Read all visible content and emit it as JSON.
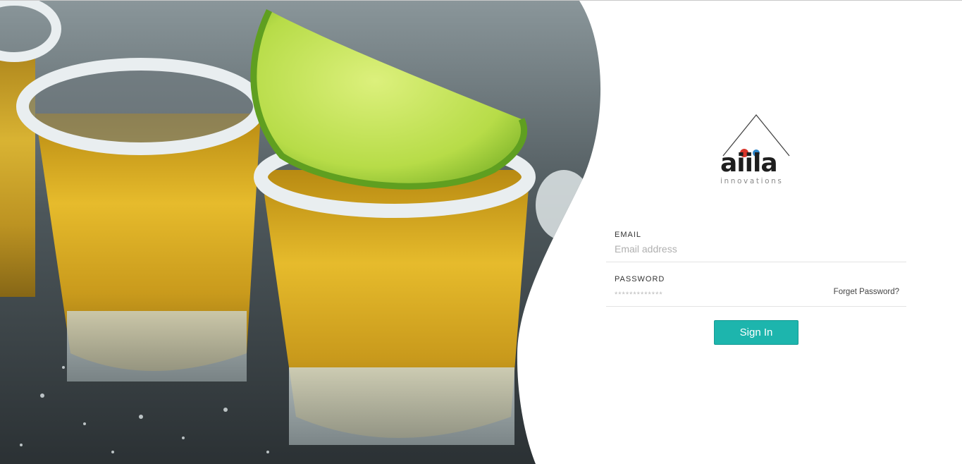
{
  "brand": {
    "name": "aiila",
    "sub": "innovations",
    "colors": {
      "roof": "#444444",
      "red_dot": "#d9352b",
      "blue_dot": "#2e86c9",
      "text": "#1e1e1e"
    }
  },
  "hero": {
    "description_icon": "tequila-shots-image",
    "colors": {
      "backdrop": "#3c4448",
      "liquid": "#d6a820",
      "salt": "#e9eef0",
      "lime": "#a8d53a"
    }
  },
  "form": {
    "email": {
      "label": "EMAIL",
      "placeholder": "Email address"
    },
    "password": {
      "label": "PASSWORD",
      "placeholder": "*************"
    },
    "forgot_label": "Forget Password?",
    "signin_label": "Sign In"
  },
  "colors": {
    "accent": "#1db5ad",
    "divider": "#e3e3e3"
  }
}
